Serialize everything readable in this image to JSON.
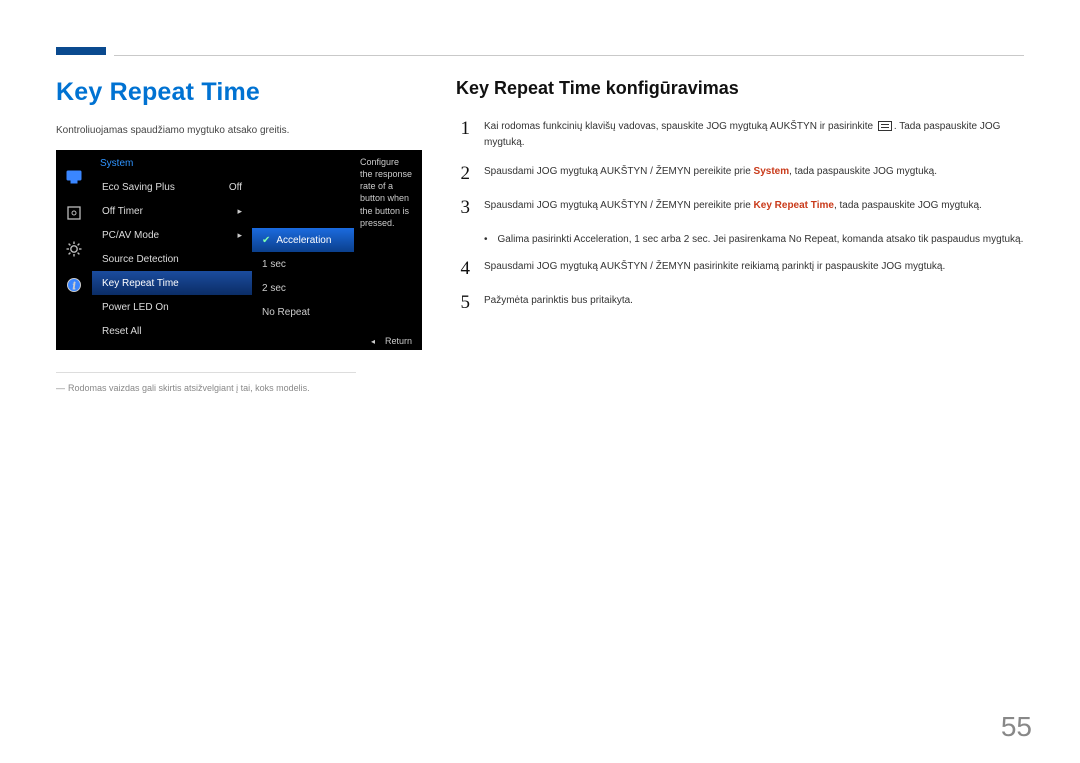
{
  "left": {
    "heading": "Key Repeat Time",
    "description": "Kontroliuojamas spaudžiamo mygtuko atsako greitis.",
    "footnote": "Rodomas vaizdas gali skirtis atsižvelgiant į tai, koks modelis."
  },
  "osd": {
    "title": "System",
    "menu": {
      "eco": {
        "label": "Eco Saving Plus",
        "value": "Off"
      },
      "offtimer": {
        "label": "Off Timer"
      },
      "pcav": {
        "label": "PC/AV Mode"
      },
      "src": {
        "label": "Source Detection"
      },
      "krt": {
        "label": "Key Repeat Time"
      },
      "led": {
        "label": "Power LED On"
      },
      "reset": {
        "label": "Reset All"
      }
    },
    "options": {
      "accel": "Acceleration",
      "s1": "1 sec",
      "s2": "2 sec",
      "nr": "No Repeat"
    },
    "hint": "Configure the response rate of a button when the button is pressed.",
    "return": "Return"
  },
  "right": {
    "heading": "Key Repeat Time konfigūravimas",
    "step1a": "Kai rodomas funkcinių klavišų vadovas, spauskite JOG mygtuką AUKŠTYN ir pasirinkite ",
    "step1b": ". Tada paspauskite JOG mygtuką.",
    "step2a": "Spausdami JOG mygtuką AUKŠTYN / ŽEMYN pereikite prie ",
    "step2_hl": "System",
    "step2b": ", tada paspauskite JOG mygtuką.",
    "step3a": "Spausdami JOG mygtuką AUKŠTYN / ŽEMYN pereikite prie ",
    "step3_hl": "Key Repeat Time",
    "step3b": ", tada paspauskite JOG mygtuką.",
    "sub_a": "Galima pasirinkti ",
    "sub_accel": "Acceleration",
    "sub_sep1": ", ",
    "sub_1sec": "1 sec",
    "sub_mid": " arba ",
    "sub_2sec": "2 sec",
    "sub_b": ". Jei pasirenkama ",
    "sub_nr": "No Repeat",
    "sub_c": ", komanda atsako tik paspaudus mygtuką.",
    "step4": "Spausdami JOG mygtuką AUKŠTYN / ŽEMYN pasirinkite reikiamą parinktį ir paspauskite JOG mygtuką.",
    "step5": "Pažymėta parinktis bus pritaikyta."
  },
  "page_number": "55"
}
